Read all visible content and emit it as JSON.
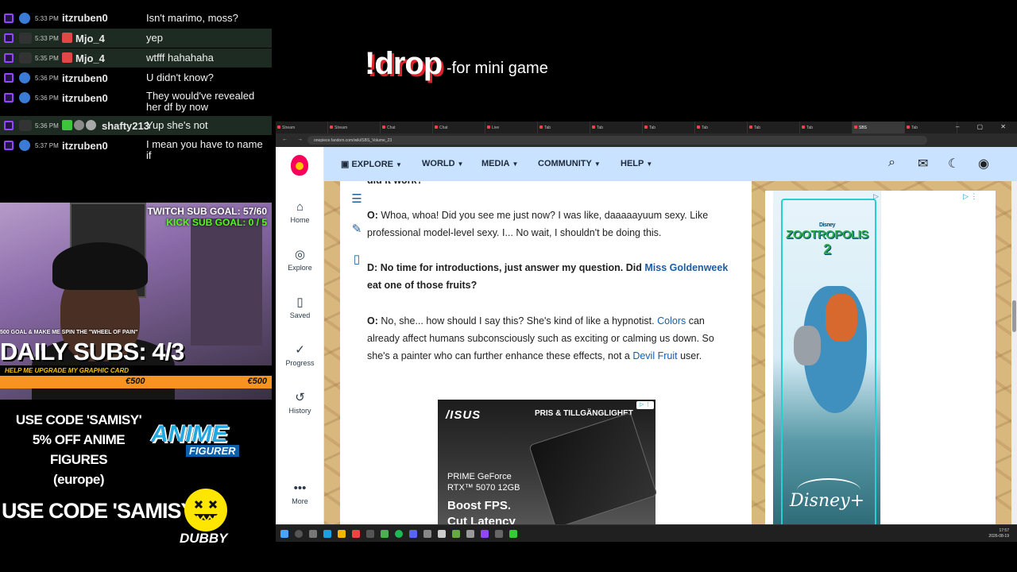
{
  "chat": {
    "messages": [
      {
        "time": "5:33 PM",
        "user": "itzruben0",
        "text": "Isn't marimo, moss?"
      },
      {
        "time": "5:33 PM",
        "user": "Mjo_4",
        "text": "yep"
      },
      {
        "time": "5:35 PM",
        "user": "Mjo_4",
        "text": "wtfff hahahaha"
      },
      {
        "time": "5:36 PM",
        "user": "itzruben0",
        "text": "U didn't know?"
      },
      {
        "time": "5:36 PM",
        "user": "itzruben0",
        "text": "They would've revealed her df by now"
      },
      {
        "time": "5:36 PM",
        "user": "shafty213",
        "text": "Yup she's not"
      },
      {
        "time": "5:37 PM",
        "user": "itzruben0",
        "text": "I mean you have to name if"
      }
    ]
  },
  "overlay": {
    "drop_command": "!drop",
    "drop_desc": "-for mini game",
    "twitch_goal": "TWITCH SUB GOAL: 57/60",
    "kick_goal": "KICK SUB GOAL: 0 / 5",
    "wheel_text": "500 GOAL & MAKE ME SPIN THE \"WHEEL OF PAIN\"",
    "daily_subs": "DAILY SUBS: 4/3",
    "upgrade_text": "HELP ME UPGRADE MY GRAPHIC CARD",
    "goal_value_1": "€500",
    "goal_value_2": "€500",
    "goal_progress": 1.0,
    "promo1_lines": [
      "USE CODE 'SAMISY'",
      "5% OFF ANIME FIGURES",
      "(europe)"
    ],
    "anime_logo": "ANIME",
    "anime_sub": "FIGURER",
    "promo2": "USE CODE 'SAMISY'",
    "dubby": "DUBBY"
  },
  "browser": {
    "url": "onepiece.fandom.com/wiki/SBS_Volume_23",
    "nav": {
      "explore": "EXPLORE",
      "world": "WORLD",
      "media": "MEDIA",
      "community": "COMMUNITY",
      "help": "HELP"
    },
    "left_nav": {
      "home": "Home",
      "explore": "Explore",
      "saved": "Saved",
      "progress": "Progress",
      "history": "History",
      "more": "More"
    },
    "article": {
      "cut_top": "did it work?",
      "p1_speaker": "O:",
      "p1_text": "Whoa, whoa! Did you see me just now? I was like, daaaaayuum sexy. Like professional model-level sexy. I... No wait, I shouldn't be doing this.",
      "p2_speaker": "D:",
      "p2_text_a": "No time for introductions, just answer my question. Did",
      "p2_link": "Miss Goldenweek",
      "p2_text_b": "eat one of those fruits?",
      "p3_speaker": "O:",
      "p3_text_a": "No, she... how should I say this? She's kind of like a hypnotist.",
      "p3_link1": "Colors",
      "p3_text_b": "can already affect humans subconsciously such as exciting or calming us down. So she's a painter who can further enhance these effects, not a",
      "p3_link2": "Devil Fruit",
      "p3_text_c": "user."
    },
    "ad_asus": {
      "brand": "/ISUS",
      "pris": "PRIS & TILLGÄNGLIGHET",
      "model_1": "PRIME GeForce",
      "model_2": "RTX™ 5070 12GB",
      "boost_1": "Boost FPS.",
      "boost_2": "Cut Latency"
    },
    "ad_zoo": {
      "small": "Disney",
      "title": "ZOOTROPOLIS",
      "number": "2",
      "brand": "Disney+"
    }
  },
  "taskbar": {
    "time": "17:57",
    "date": "2026-08-19"
  }
}
